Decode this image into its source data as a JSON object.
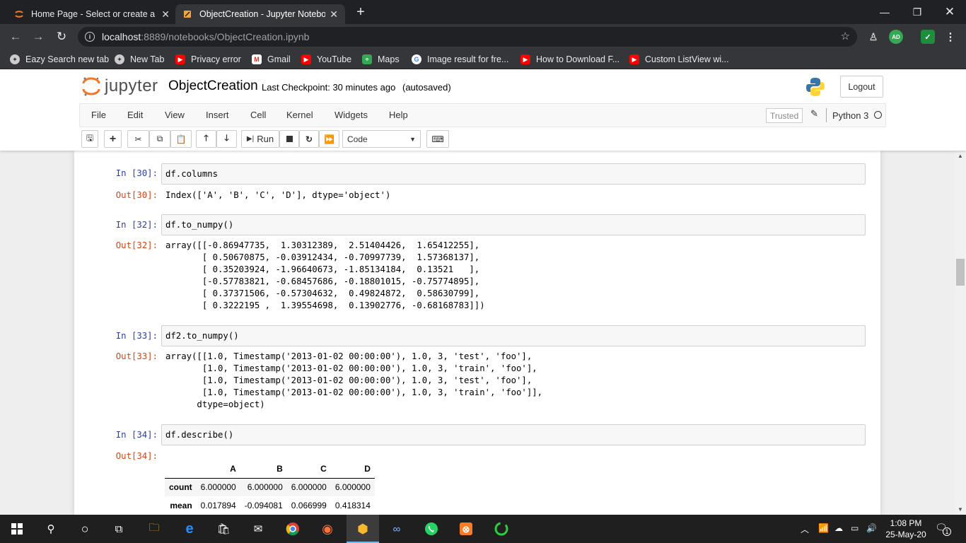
{
  "browser": {
    "tabs": [
      {
        "label": "Home Page - Select or create a n",
        "active": false
      },
      {
        "label": "ObjectCreation - Jupyter Notebo",
        "active": true
      }
    ],
    "address": {
      "host": "localhost",
      "path": ":8889/notebooks/ObjectCreation.ipynb"
    },
    "profile_badge": "AD",
    "bookmarks": [
      "Eazy Search new tab",
      "New Tab",
      "Privacy error",
      "Gmail",
      "YouTube",
      "Maps",
      "Image result for fre...",
      "How to Download F...",
      "Custom ListView wi..."
    ]
  },
  "jupyter": {
    "logo_text": "jupyter",
    "notebook_name": "ObjectCreation",
    "checkpoint": "Last Checkpoint: 30 minutes ago",
    "autosave": "(autosaved)",
    "logout_label": "Logout",
    "menu": [
      "File",
      "Edit",
      "View",
      "Insert",
      "Cell",
      "Kernel",
      "Widgets",
      "Help"
    ],
    "trusted_label": "Trusted",
    "kernel_name": "Python 3",
    "run_label": "Run",
    "cell_type": "Code"
  },
  "cells": [
    {
      "in": "In [30]:",
      "code": "df.columns",
      "out": "Out[30]:",
      "output": "Index(['A', 'B', 'C', 'D'], dtype='object')"
    },
    {
      "in": "In [32]:",
      "code": "df.to_numpy()",
      "out": "Out[32]:",
      "output": "array([[-0.86947735,  1.30312389,  2.51404426,  1.65412255],\n       [ 0.50670875, -0.03912434, -0.70997739,  1.57368137],\n       [ 0.35203924, -1.96640673, -1.85134184,  0.13521   ],\n       [-0.57783821, -0.68457686, -0.18801015, -0.75774895],\n       [ 0.37371506, -0.57304632,  0.49824872,  0.58630799],\n       [ 0.3222195 ,  1.39554698,  0.13902776, -0.68168783]])"
    },
    {
      "in": "In [33]:",
      "code": "df2.to_numpy()",
      "out": "Out[33]:",
      "output": "array([[1.0, Timestamp('2013-01-02 00:00:00'), 1.0, 3, 'test', 'foo'],\n       [1.0, Timestamp('2013-01-02 00:00:00'), 1.0, 3, 'train', 'foo'],\n       [1.0, Timestamp('2013-01-02 00:00:00'), 1.0, 3, 'test', 'foo'],\n       [1.0, Timestamp('2013-01-02 00:00:00'), 1.0, 3, 'train', 'foo']],\n      dtype=object)"
    },
    {
      "in": "In [34]:",
      "code": "df.describe()",
      "out": "Out[34]:"
    }
  ],
  "describe_table": {
    "columns": [
      "",
      "A",
      "B",
      "C",
      "D"
    ],
    "rows": [
      {
        "label": "count",
        "values": [
          "6.000000",
          "6.000000",
          "6.000000",
          "6.000000"
        ]
      },
      {
        "label": "mean",
        "values": [
          "0.017894",
          "-0.094081",
          "0.066999",
          "0.418314"
        ]
      }
    ]
  },
  "taskbar": {
    "time": "1:08 PM",
    "date": "25-May-20",
    "notification_count": "1"
  }
}
